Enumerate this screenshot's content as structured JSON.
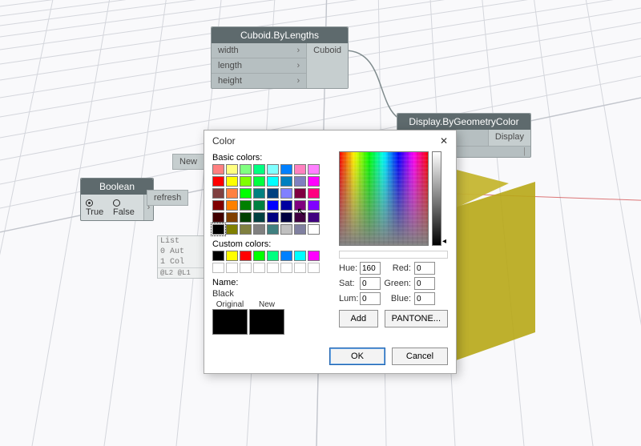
{
  "nodes": {
    "cuboid": {
      "title": "Cuboid.ByLengths",
      "ports_in": [
        "width",
        "length",
        "height"
      ],
      "port_out": "Cuboid"
    },
    "display": {
      "title": "Display.ByGeometryColor",
      "port_out": "Display"
    },
    "boolean": {
      "title": "Boolean",
      "true_label": "True",
      "false_label": "False"
    }
  },
  "fragments": {
    "new": "New",
    "refresh": "refresh"
  },
  "list_panel": {
    "header": "List",
    "rows": [
      "0 Aut",
      "1 Col"
    ],
    "footer": "@L2 @L1"
  },
  "color_dialog": {
    "title": "Color",
    "basic_label": "Basic colors:",
    "custom_label": "Custom colors:",
    "name_label": "Name:",
    "name_value": "Black",
    "original_label": "Original",
    "new_label": "New",
    "hue_label": "Hue:",
    "hue_value": "160",
    "sat_label": "Sat:",
    "sat_value": "0",
    "lum_label": "Lum:",
    "lum_value": "0",
    "red_label": "Red:",
    "red_value": "0",
    "green_label": "Green:",
    "green_value": "0",
    "blue_label": "Blue:",
    "blue_value": "0",
    "add_btn": "Add",
    "pantone_btn": "PANTONE...",
    "ok_btn": "OK",
    "cancel_btn": "Cancel",
    "basic_colors": [
      "#ff8080",
      "#ffff80",
      "#80ff80",
      "#00ff80",
      "#80ffff",
      "#0080ff",
      "#ff80c0",
      "#ff80ff",
      "#ff0000",
      "#ffff00",
      "#80ff00",
      "#00ff40",
      "#00ffff",
      "#0080c0",
      "#8080c0",
      "#ff00ff",
      "#804040",
      "#ff8040",
      "#00ff00",
      "#008080",
      "#004080",
      "#8080ff",
      "#800040",
      "#ff0080",
      "#800000",
      "#ff8000",
      "#008000",
      "#008040",
      "#0000ff",
      "#0000a0",
      "#800080",
      "#8000ff",
      "#400000",
      "#804000",
      "#004000",
      "#004040",
      "#000080",
      "#000040",
      "#400040",
      "#400080",
      "#000000",
      "#808000",
      "#808040",
      "#808080",
      "#408080",
      "#c0c0c0",
      "#8080a0",
      "#ffffff"
    ],
    "custom_colors": [
      "#000000",
      "#ffff00",
      "#ff0000",
      "#00ff00",
      "#00ff80",
      "#0080ff",
      "#00ffff",
      "#ff00ff",
      "",
      "",
      "",
      "",
      "",
      "",
      "",
      ""
    ]
  }
}
